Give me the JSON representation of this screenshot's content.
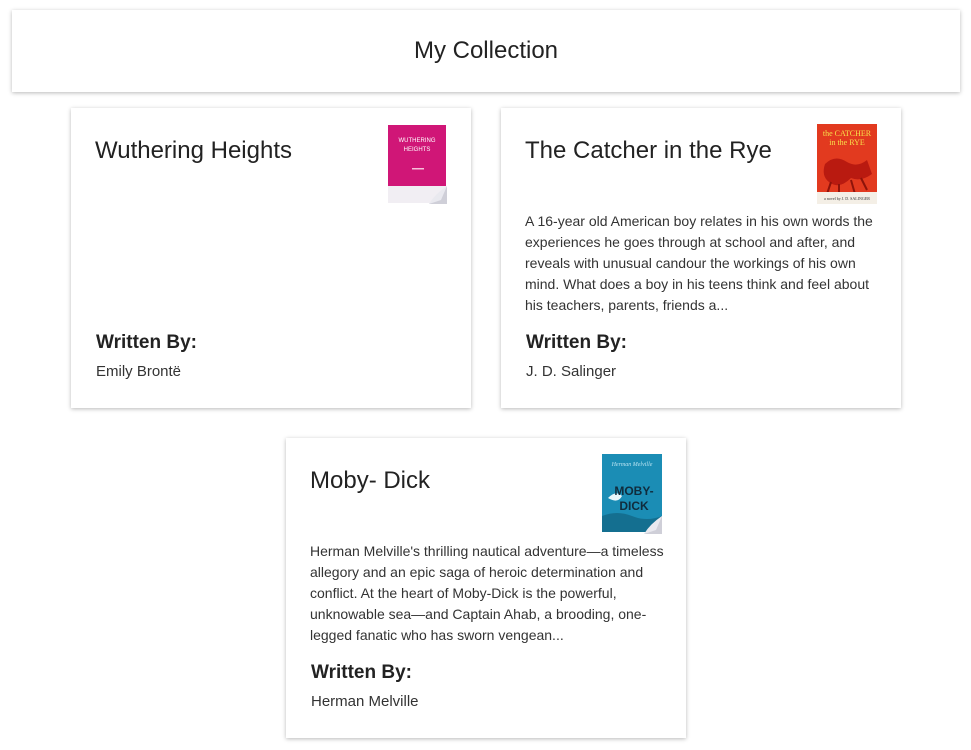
{
  "header": {
    "title": "My Collection"
  },
  "books": [
    {
      "title": "Wuthering Heights",
      "description": "",
      "written_by_label": "Written By:",
      "author": "Emily Brontë",
      "cover": {
        "icon": "wuthering-heights-cover",
        "bg": "#d8157a",
        "text": "WUTHERING HEIGHTS"
      }
    },
    {
      "title": "The Catcher in the Rye",
      "description": "A 16-year old American boy relates in his own words the experiences he goes through at school and after, and reveals with unusual candour the workings of his own mind. What does a boy in his teens think and feel about his teachers, parents, friends a...",
      "written_by_label": "Written By:",
      "author": "J. D. Salinger",
      "cover": {
        "icon": "catcher-in-the-rye-cover",
        "bg": "#e8331c",
        "text": "the CATCHER in the RYE"
      }
    },
    {
      "title": "Moby- Dick",
      "description": "Herman Melville's thrilling nautical adventure—a timeless allegory and an epic saga of heroic determination and conflict. At the heart of Moby-Dick is the powerful, unknowable sea—and Captain Ahab, a brooding, one-legged fanatic who has sworn vengean...",
      "written_by_label": "Written By:",
      "author": "Herman Melville",
      "cover": {
        "icon": "moby-dick-cover",
        "bg": "#1a8fb8",
        "text": "MOBY-DICK"
      }
    }
  ]
}
